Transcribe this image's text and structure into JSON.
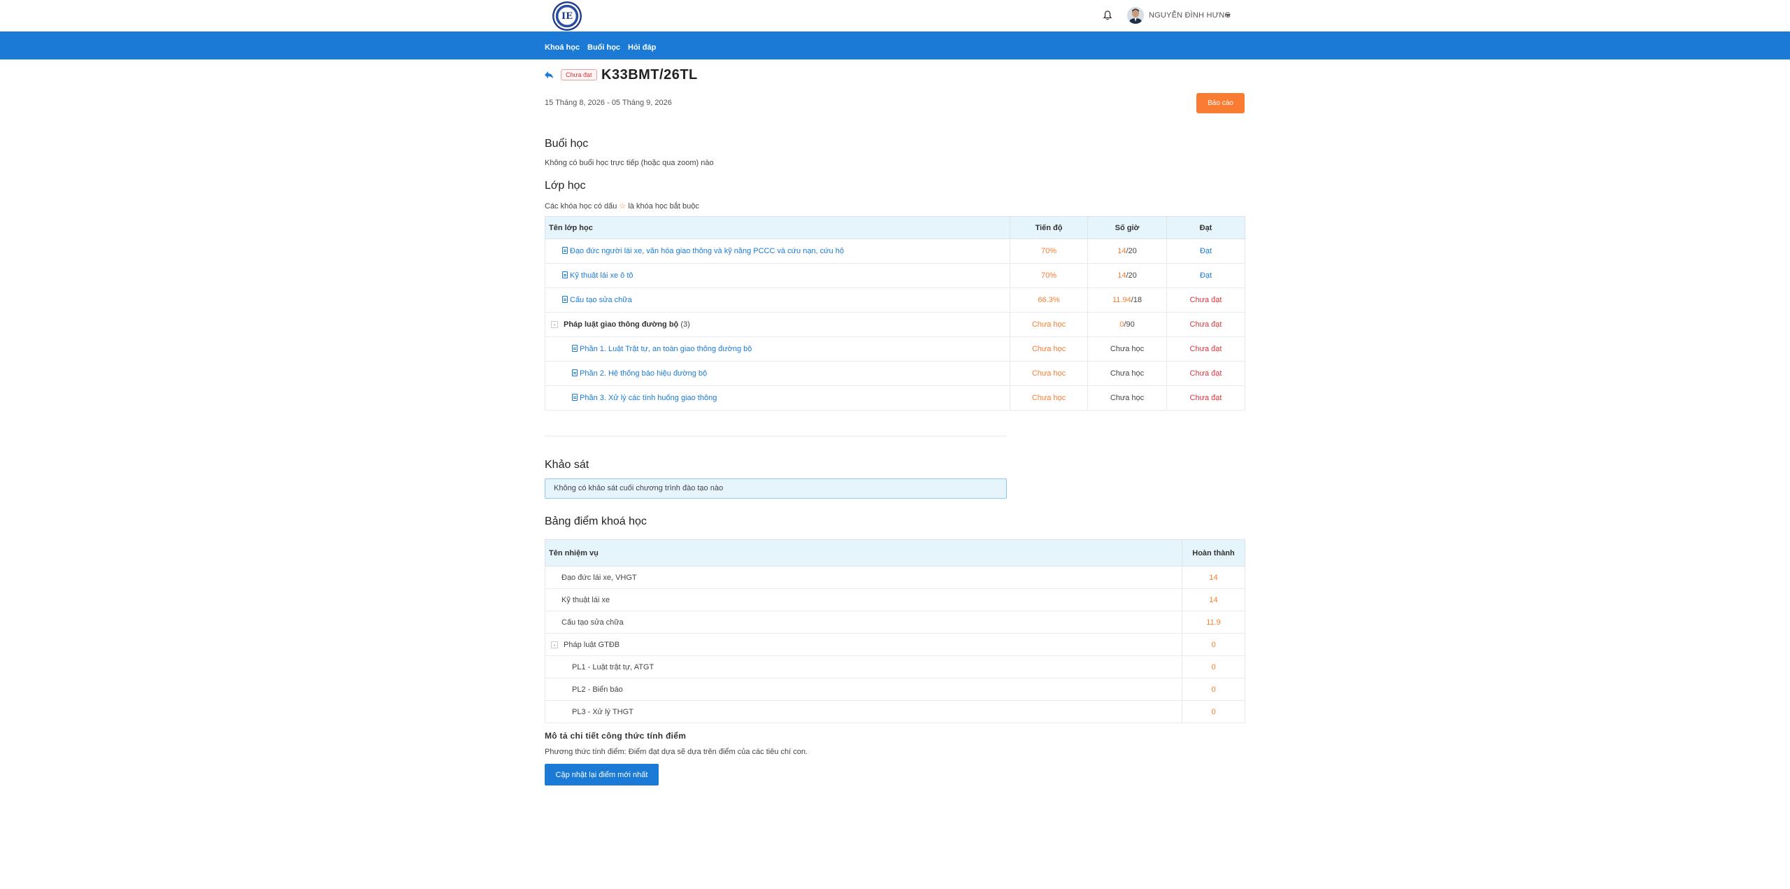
{
  "header": {
    "logo_text": "IE",
    "user_name": "NGUYỄN ĐÌNH HƯNG"
  },
  "nav": {
    "items": [
      "Khoá học",
      "Buổi học",
      "Hỏi đáp"
    ]
  },
  "course": {
    "status": "Chưa đạt",
    "title": "K33BMT/26TL",
    "date_range": "15 Tháng 8, 2026 - 05 Tháng 9, 2026",
    "report_button": "Báo cáo"
  },
  "sessions": {
    "title": "Buổi học",
    "empty_text": "Không có buổi học trực tiếp (hoặc qua zoom) nào"
  },
  "classes": {
    "title": "Lớp học",
    "note_before": "Các khóa học có dấu",
    "note_star": "☆",
    "note_after": "là khóa học bắt buộc",
    "headers": {
      "name": "Tên lớp học",
      "progress": "Tiến độ",
      "hours": "Số giờ",
      "passed": "Đạt"
    },
    "rows": [
      {
        "name": "Đạo đức người lái xe, văn hóa giao thông và kỹ năng PCCC và cứu nạn, cứu hộ",
        "progress": "70%",
        "hours_done": "14",
        "hours_total": "/20",
        "passed": "Đạt"
      },
      {
        "name": "Kỹ thuật lái xe ô tô",
        "progress": "70%",
        "hours_done": "14",
        "hours_total": "/20",
        "passed": "Đạt"
      },
      {
        "name": "Cấu tạo sửa chữa",
        "progress": "66.3%",
        "hours_done": "11.94",
        "hours_total": "/18",
        "passed": "Chưa đạt"
      },
      {
        "name": "Pháp luật giao thông đường bộ",
        "count": "(3)",
        "progress": "Chưa học",
        "hours_done": "0",
        "hours_total": "/90",
        "passed": "Chưa đạt"
      },
      {
        "name": "Phần 1. Luật Trật tự, an toàn giao thông đường bộ",
        "progress": "Chưa học",
        "hours": "Chưa học",
        "passed": "Chưa đạt"
      },
      {
        "name": "Phần 2. Hệ thống báo hiệu đường bộ",
        "progress": "Chưa học",
        "hours": "Chưa học",
        "passed": "Chưa đạt"
      },
      {
        "name": "Phần 3. Xử lý các tình huống giao thông",
        "progress": "Chưa học",
        "hours": "Chưa học",
        "passed": "Chưa đạt"
      }
    ]
  },
  "survey": {
    "title": "Khảo sát",
    "empty_text": "Không có khảo sát cuối chương trình đào tạo nào"
  },
  "scores": {
    "title": "Bảng điểm khoá học",
    "headers": {
      "task": "Tên nhiệm vụ",
      "complete": "Hoàn thành"
    },
    "rows": [
      {
        "name": "Đạo đức lái xe, VHGT",
        "value": "14"
      },
      {
        "name": "Kỹ thuật lái xe",
        "value": "14"
      },
      {
        "name": "Cấu tạo sửa chữa",
        "value": "11.9"
      },
      {
        "name": "Pháp luật GTĐB",
        "value": "0"
      },
      {
        "name": "PL1 - Luật trật tự, ATGT",
        "value": "0"
      },
      {
        "name": "PL2 - Biển báo",
        "value": "0"
      },
      {
        "name": "PL3 - Xử lý THGT",
        "value": "0"
      }
    ]
  },
  "formula": {
    "title": "Mô tả chi tiết công thức tính điểm",
    "description": "Phương thức tính điểm: Điểm đạt dựa sẽ dựa trên điểm của các tiêu chí con.",
    "update_button": "Cập nhật lại điểm mới nhất"
  },
  "colors": {
    "brand_blue": "#1a7ad6",
    "accent_orange": "#fa7c32",
    "fail_red": "#d9363e"
  },
  "icons": [
    "logo",
    "bell-icon",
    "avatar",
    "back-arrow-icon",
    "document-icon",
    "collapse-icon"
  ]
}
